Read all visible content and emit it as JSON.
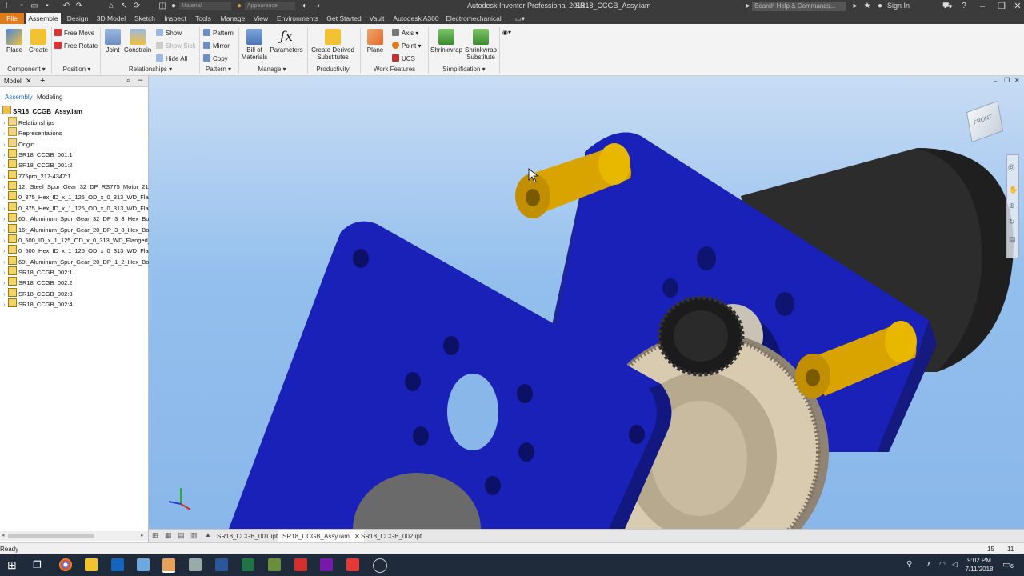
{
  "title": {
    "app": "Autodesk Inventor Professional 2018",
    "document": "SR18_CCGB_Assy.iam",
    "search_placeholder": "Search Help & Commands...",
    "sign_in": "Sign In",
    "material": "Material",
    "appearance": "Appearance"
  },
  "menu_tabs": [
    "File",
    "Assemble",
    "Design",
    "3D Model",
    "Sketch",
    "Inspect",
    "Tools",
    "Manage",
    "View",
    "Environments",
    "Get Started",
    "Vault",
    "Autodesk A360",
    "Electromechanical"
  ],
  "ribbon": {
    "place": "Place",
    "create": "Create",
    "free_move": "Free Move",
    "free_rotate": "Free Rotate",
    "joint": "Joint",
    "constrain": "Constrain",
    "show": "Show",
    "show_sick": "Show Sick",
    "hide_all": "Hide All",
    "pattern": "Pattern",
    "mirror": "Mirror",
    "copy": "Copy",
    "bom_line1": "Bill of",
    "bom_line2": "Materials",
    "parameters": "Parameters",
    "cds_line1": "Create Derived",
    "cds_line2": "Substitutes",
    "plane": "Plane",
    "axis": "Axis",
    "point": "Point",
    "ucs": "UCS",
    "shrinkwrap": "Shrinkwrap",
    "sws_line1": "Shrinkwrap",
    "sws_line2": "Substitute",
    "panels": {
      "component": "Component",
      "position": "Position",
      "relationships": "Relationships",
      "pattern": "Pattern",
      "manage": "Manage",
      "productivity": "Productivity",
      "work_features": "Work Features",
      "simplification": "Simplification"
    }
  },
  "browser": {
    "tab": "Model",
    "sub_tabs": [
      "Assembly",
      "Modeling"
    ],
    "root": "SR18_CCGB_Assy.iam",
    "items": [
      {
        "label": "Relationships",
        "kind": "folder"
      },
      {
        "label": "Representations",
        "kind": "folder"
      },
      {
        "label": "Origin",
        "kind": "folder"
      },
      {
        "label": "SR18_CCGB_001:1",
        "kind": "part"
      },
      {
        "label": "SR18_CCGB_001:2",
        "kind": "part"
      },
      {
        "label": "775pro_217-4347:1",
        "kind": "part"
      },
      {
        "label": "12t_Steel_Spur_Gear_32_DP_RS775_Motor_217-",
        "kind": "part"
      },
      {
        "label": "0_375_Hex_ID_x_1_125_OD_x_0_313_WD_Flan",
        "kind": "part"
      },
      {
        "label": "0_375_Hex_ID_x_1_125_OD_x_0_313_WD_Flan",
        "kind": "part"
      },
      {
        "label": "60t_Aluminum_Spur_Gear_32_DP_3_8_Hex_Bore",
        "kind": "part"
      },
      {
        "label": "16t_Aluminum_Spur_Gear_20_DP_3_8_Hex_Bore",
        "kind": "part"
      },
      {
        "label": "0_500_ID_x_1_125_OD_x_0_313_WD_Flanged_",
        "kind": "part"
      },
      {
        "label": "0_500_Hex_ID_x_1_125_OD_x_0_313_WD_Flan",
        "kind": "part"
      },
      {
        "label": "60t_Aluminum_Spur_Gear_20_DP_1_2_Hex_Bore",
        "kind": "part"
      },
      {
        "label": "SR18_CCGB_002:1",
        "kind": "part"
      },
      {
        "label": "SR18_CCGB_002:2",
        "kind": "part"
      },
      {
        "label": "SR18_CCGB_002:3",
        "kind": "part"
      },
      {
        "label": "SR18_CCGB_002:4",
        "kind": "part"
      }
    ]
  },
  "viewcube_face": "FRONT",
  "doc_tabs": [
    {
      "label": "SR18_CCGB_001.ipt",
      "active": false
    },
    {
      "label": "SR18_CCGB_Assy.iam",
      "active": true
    },
    {
      "label": "SR18_CCGB_002.ipt",
      "active": false
    }
  ],
  "status": {
    "text": "Ready",
    "count_a": "15",
    "count_b": "11"
  },
  "clock": {
    "time": "9:02 PM",
    "date": "7/11/2018"
  },
  "notification_count": "6",
  "colors": {
    "file_tab": "#e07a1c",
    "plate": "#1c22b8",
    "standoff": "#d9a300",
    "gear": "#c8b897",
    "pinion": "#222222",
    "motor": "#2a2a2a",
    "viewport_bg": "#8ab7ea"
  }
}
